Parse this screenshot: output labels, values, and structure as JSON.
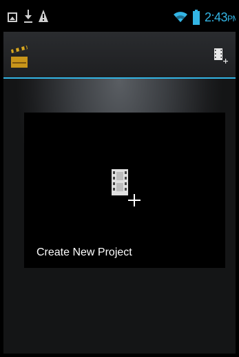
{
  "status_bar": {
    "time": "2:43",
    "ampm": "PM",
    "icons": [
      "gallery-icon",
      "download-icon",
      "warning-icon",
      "wifi-icon",
      "battery-icon"
    ],
    "accent_color": "#33b5e5"
  },
  "action_bar": {
    "logo_icon": "clapperboard-icon",
    "action_icon": "new-project-icon",
    "divider_color": "#33b5e5"
  },
  "main": {
    "create_label": "Create New Project",
    "create_icon": "film-add-icon"
  }
}
